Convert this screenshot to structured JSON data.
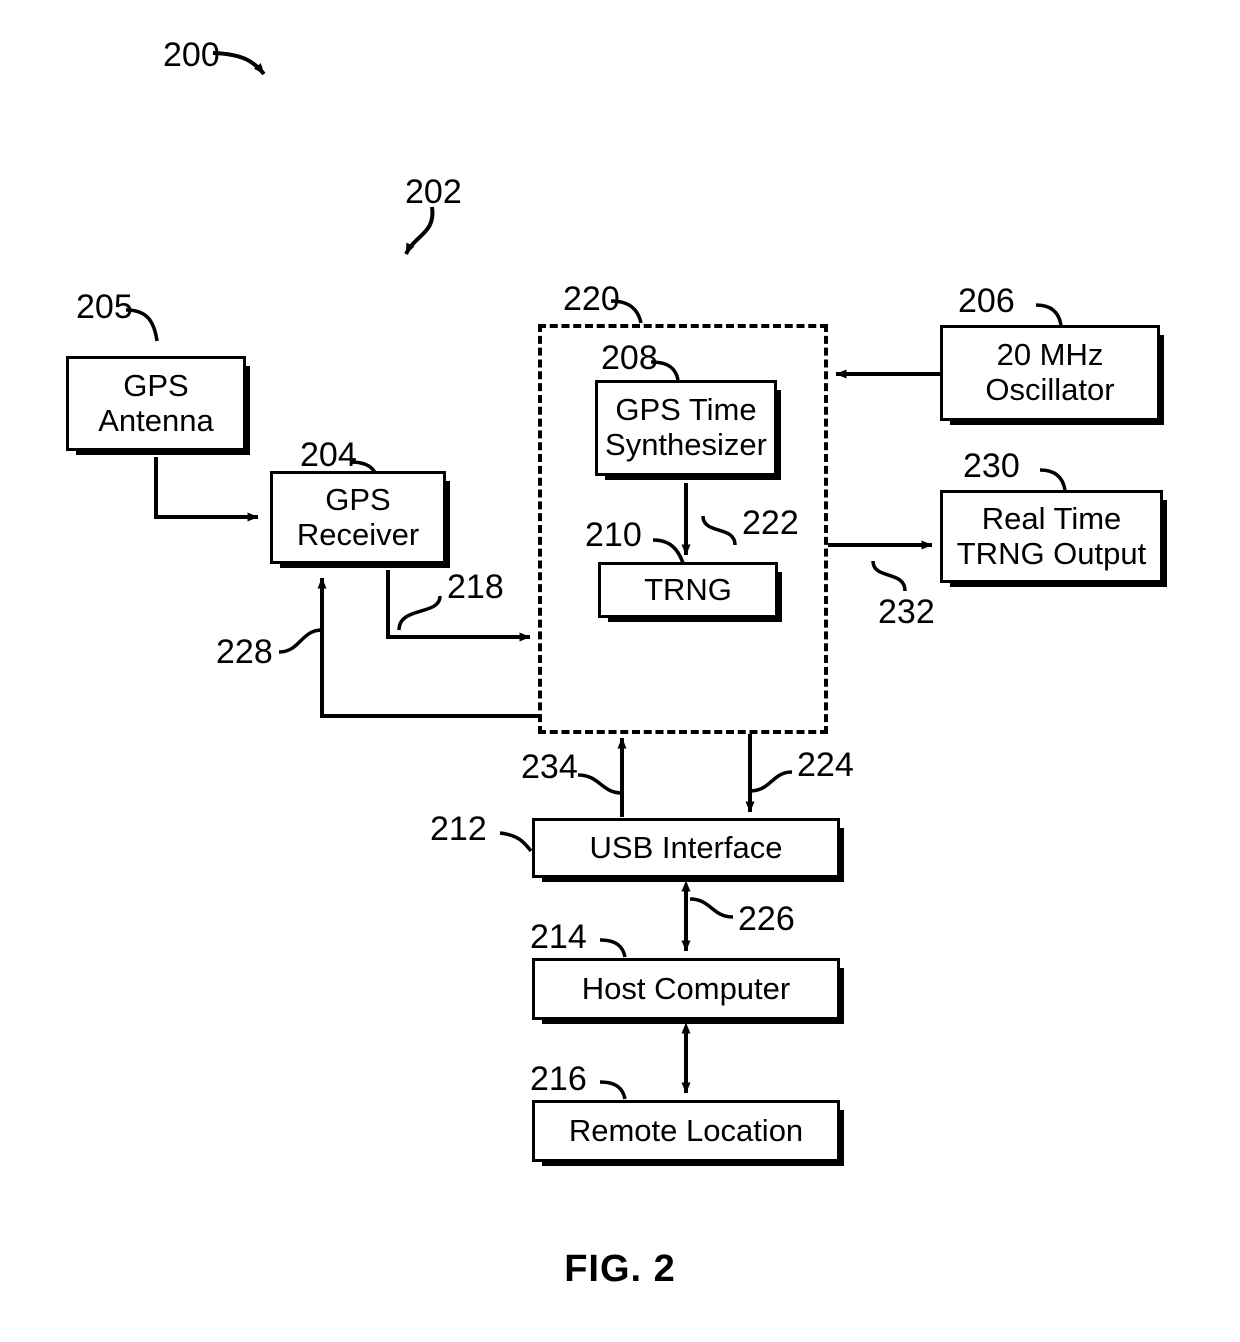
{
  "figure": {
    "caption": "FIG. 2",
    "system_ref": "200",
    "device_ref": "202"
  },
  "blocks": [
    {
      "id": "gps-antenna",
      "ref": "205",
      "label": "GPS\nAntenna"
    },
    {
      "id": "gps-receiver",
      "ref": "204",
      "label": "GPS\nReceiver"
    },
    {
      "id": "gps-time-synthesizer",
      "ref": "208",
      "label": "GPS Time\nSynthesizer"
    },
    {
      "id": "trng",
      "ref": "210",
      "label": "TRNG"
    },
    {
      "id": "oscillator",
      "ref": "206",
      "label": "20 MHz\nOscillator"
    },
    {
      "id": "real-time-trng-output",
      "ref": "230",
      "label": "Real Time\nTRNG Output"
    },
    {
      "id": "usb-interface",
      "ref": "212",
      "label": "USB Interface"
    },
    {
      "id": "host-computer",
      "ref": "214",
      "label": "Host Computer"
    },
    {
      "id": "remote-location",
      "ref": "216",
      "label": "Remote Location"
    }
  ],
  "enclosure": {
    "id": "trng-module",
    "ref": "220"
  },
  "connections": [
    {
      "id": "antenna-to-receiver",
      "ref": "",
      "from": "gps-antenna",
      "to": "gps-receiver",
      "arrow": "single"
    },
    {
      "id": "receiver-to-module",
      "ref": "218",
      "from": "gps-receiver",
      "to": "trng-module",
      "arrow": "single"
    },
    {
      "id": "module-to-receiver",
      "ref": "228",
      "from": "trng-module",
      "to": "gps-receiver",
      "arrow": "single"
    },
    {
      "id": "synthesizer-to-trng",
      "ref": "222",
      "from": "gps-time-synthesizer",
      "to": "trng",
      "arrow": "single"
    },
    {
      "id": "oscillator-to-module",
      "ref": "",
      "from": "oscillator",
      "to": "trng-module",
      "arrow": "single"
    },
    {
      "id": "module-to-trng-output",
      "ref": "232",
      "from": "trng-module",
      "to": "real-time-trng-output",
      "arrow": "single"
    },
    {
      "id": "usb-to-module",
      "ref": "234",
      "from": "usb-interface",
      "to": "trng-module",
      "arrow": "single"
    },
    {
      "id": "module-to-usb",
      "ref": "224",
      "from": "trng-module",
      "to": "usb-interface",
      "arrow": "single"
    },
    {
      "id": "usb-to-host",
      "ref": "226",
      "from": "usb-interface",
      "to": "host-computer",
      "arrow": "double"
    },
    {
      "id": "host-to-remote",
      "ref": "",
      "from": "host-computer",
      "to": "remote-location",
      "arrow": "double"
    }
  ]
}
